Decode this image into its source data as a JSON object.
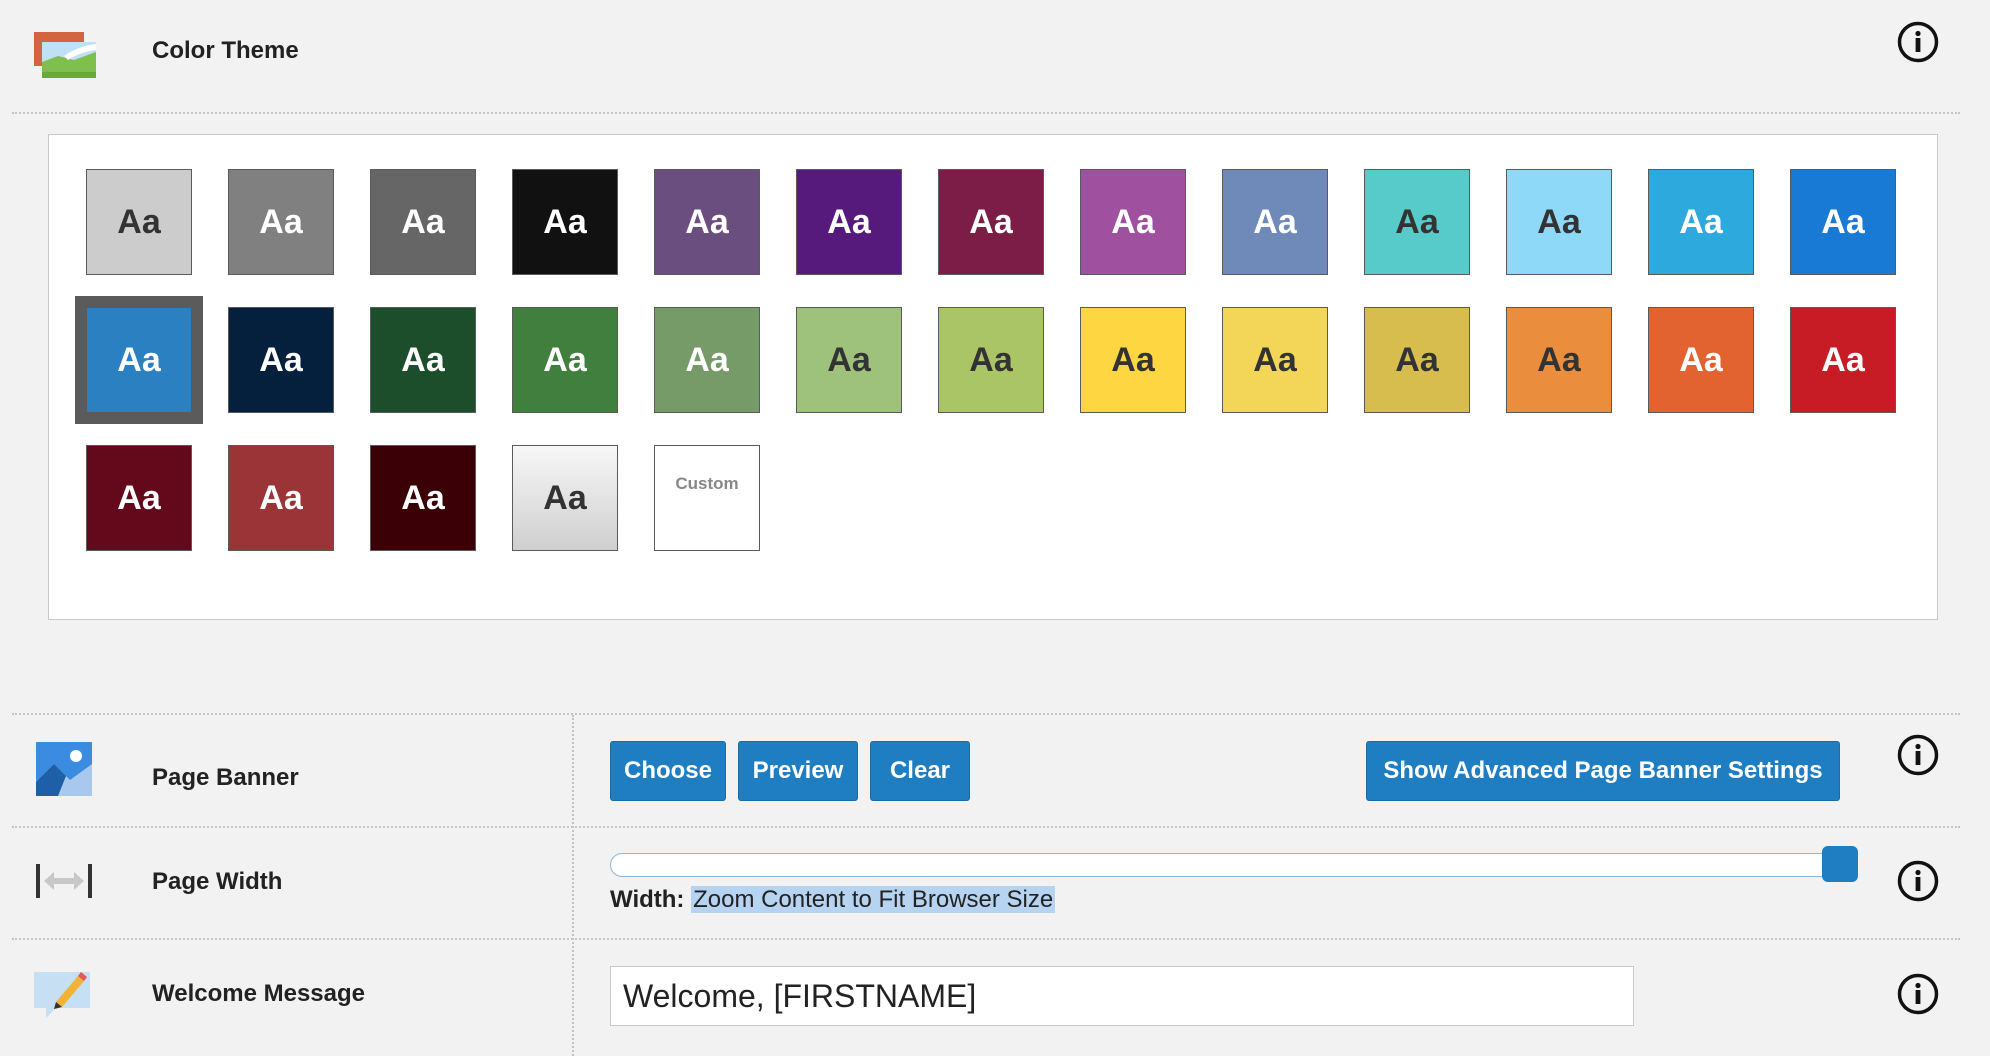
{
  "color_theme": {
    "label": "Color Theme",
    "swatches": [
      {
        "label": "Aa",
        "bg": "#cccccc",
        "fg": "#333333"
      },
      {
        "label": "Aa",
        "bg": "#808080",
        "fg": "#ffffff"
      },
      {
        "label": "Aa",
        "bg": "#666666",
        "fg": "#ffffff"
      },
      {
        "label": "Aa",
        "bg": "#111111",
        "fg": "#ffffff"
      },
      {
        "label": "Aa",
        "bg": "#6a4e7f",
        "fg": "#ffffff"
      },
      {
        "label": "Aa",
        "bg": "#561a7c",
        "fg": "#ffffff"
      },
      {
        "label": "Aa",
        "bg": "#7b1d47",
        "fg": "#ffffff"
      },
      {
        "label": "Aa",
        "bg": "#9f519f",
        "fg": "#ffffff"
      },
      {
        "label": "Aa",
        "bg": "#6f8ab8",
        "fg": "#ffffff"
      },
      {
        "label": "Aa",
        "bg": "#56cbc9",
        "fg": "#333333"
      },
      {
        "label": "Aa",
        "bg": "#8dd9f7",
        "fg": "#333333"
      },
      {
        "label": "Aa",
        "bg": "#2ea9dd",
        "fg": "#ffffff"
      },
      {
        "label": "Aa",
        "bg": "#197ad5",
        "fg": "#ffffff"
      },
      {
        "label": "Aa",
        "bg": "#2a80c0",
        "fg": "#ffffff",
        "selected": true
      },
      {
        "label": "Aa",
        "bg": "#04203d",
        "fg": "#ffffff"
      },
      {
        "label": "Aa",
        "bg": "#1c4e2b",
        "fg": "#ffffff"
      },
      {
        "label": "Aa",
        "bg": "#417f3f",
        "fg": "#ffffff"
      },
      {
        "label": "Aa",
        "bg": "#779b68",
        "fg": "#ffffff"
      },
      {
        "label": "Aa",
        "bg": "#9ec27b",
        "fg": "#333333"
      },
      {
        "label": "Aa",
        "bg": "#a9c566",
        "fg": "#333333"
      },
      {
        "label": "Aa",
        "bg": "#fed641",
        "fg": "#333333"
      },
      {
        "label": "Aa",
        "bg": "#f3d658",
        "fg": "#333333"
      },
      {
        "label": "Aa",
        "bg": "#d6bd4d",
        "fg": "#333333"
      },
      {
        "label": "Aa",
        "bg": "#ea8d3d",
        "fg": "#333333"
      },
      {
        "label": "Aa",
        "bg": "#e36330",
        "fg": "#ffffff"
      },
      {
        "label": "Aa",
        "bg": "#c71c25",
        "fg": "#ffffff"
      },
      {
        "label": "Aa",
        "bg": "#64081b",
        "fg": "#ffffff"
      },
      {
        "label": "Aa",
        "bg": "#9a3436",
        "fg": "#ffffff"
      },
      {
        "label": "Aa",
        "bg": "#3a0006",
        "fg": "#ffffff"
      },
      {
        "label": "Aa",
        "bg": "gradient",
        "fg": "#333333"
      },
      {
        "label": "Custom",
        "bg": "#ffffff",
        "fg": "#888888",
        "custom": true
      }
    ]
  },
  "page_banner": {
    "label": "Page Banner",
    "choose": "Choose",
    "preview": "Preview",
    "clear": "Clear",
    "advanced": "Show Advanced Page Banner Settings"
  },
  "page_width": {
    "label": "Page Width",
    "caption_prefix": "Width:",
    "caption_value": "Zoom Content to Fit Browser Size",
    "slider_fraction": 1.0
  },
  "welcome": {
    "label": "Welcome Message",
    "value": "Welcome, [FIRSTNAME]"
  },
  "colors": {
    "accent": "#1f7ec1"
  }
}
